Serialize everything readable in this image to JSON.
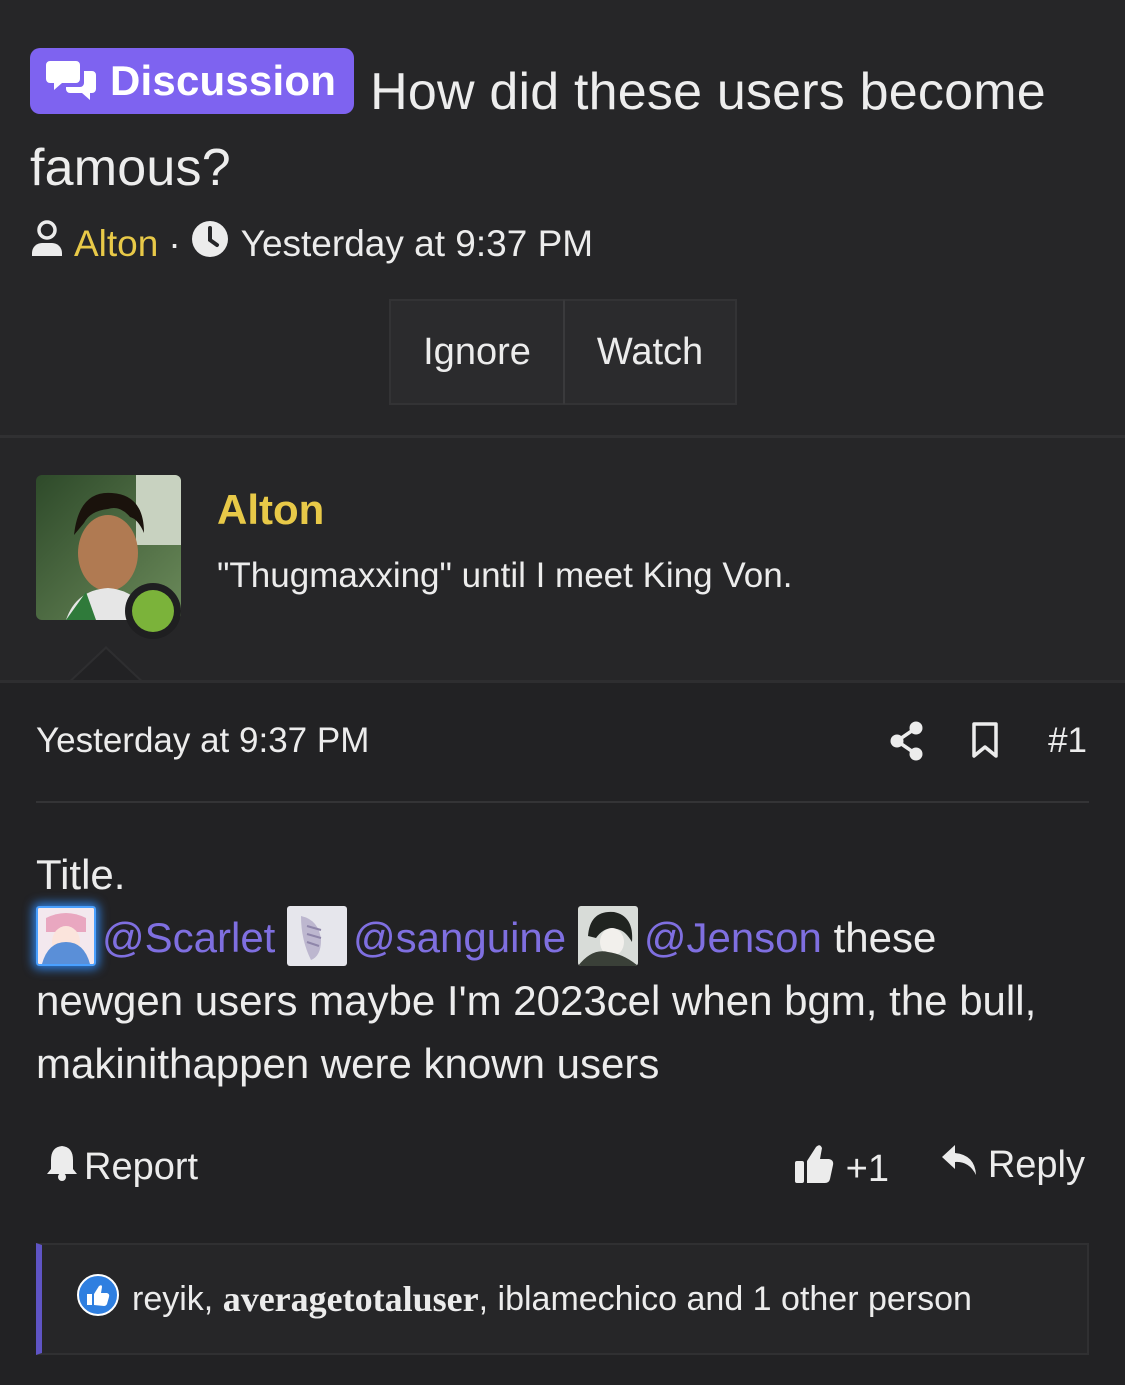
{
  "thread": {
    "prefix_label": "Discussion",
    "title_part1": "How did these users become",
    "title_part2": "famous?",
    "author": "Alton",
    "separator": "·",
    "timestamp": "Yesterday at 9:37 PM",
    "ignore_label": "Ignore",
    "watch_label": "Watch"
  },
  "poster": {
    "name": "Alton",
    "custom_title": "\"Thugmaxxing\" until I meet King Von.",
    "online": true
  },
  "post": {
    "date": "Yesterday at 9:37 PM",
    "number": "#1",
    "line1": "Title.",
    "mentions": [
      "@Scarlet",
      "@sanguine",
      "@Jenson"
    ],
    "text_after_mentions": "these",
    "text_rest": "newgen users maybe I'm 2023cel when bgm, the bull, makinithappen were known users",
    "report_label": "Report",
    "like_label": "+1",
    "reply_label": "Reply"
  },
  "reactions": {
    "user1": "reyik",
    "comma1": ",",
    "user2": "averagetotaluser",
    "comma2": ",",
    "user3": "iblamechico",
    "suffix": "and 1 other person"
  },
  "colors": {
    "accent": "#7e63f0",
    "username": "#e8c948",
    "mention": "#7f6fe0",
    "online": "#7bb33a",
    "background": "#222224"
  }
}
